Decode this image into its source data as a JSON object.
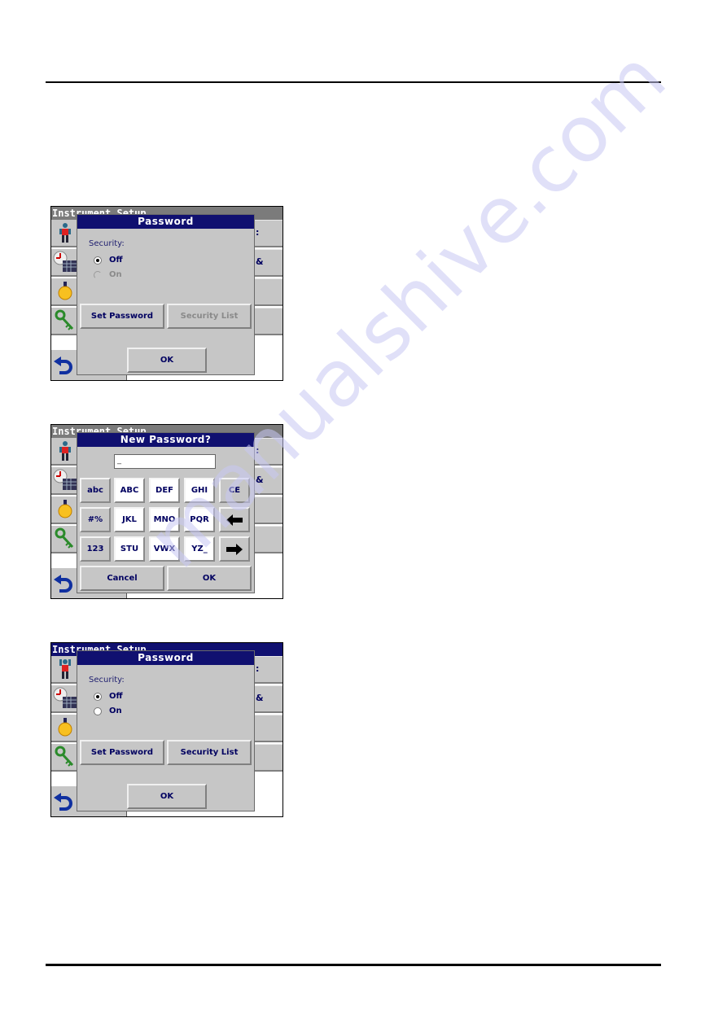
{
  "watermark": "manualshive.com",
  "screens": [
    {
      "app_title": "Instrument Setup",
      "right_buttons": [
        ":",
        "&",
        "",
        ""
      ],
      "dialog": {
        "title": "Password",
        "security_label": "Security:",
        "options": [
          {
            "label": "Off",
            "checked": true,
            "enabled": true
          },
          {
            "label": "On",
            "checked": false,
            "enabled": false
          }
        ],
        "set_password": "Set Password",
        "security_list": "Security List",
        "security_list_enabled": false,
        "ok": "OK"
      }
    },
    {
      "app_title": "Instrument Setup",
      "right_buttons": [
        ":",
        "&",
        "",
        ""
      ],
      "dialog": {
        "title": "New Password?",
        "input_value": "_",
        "keys": [
          [
            "abc",
            "ABC",
            "DEF",
            "GHI",
            "CE"
          ],
          [
            "#%",
            "JKL",
            "MNO",
            "PQR",
            "backspace-arrow"
          ],
          [
            "123",
            "STU",
            "VWX",
            "YZ_",
            "forward-arrow"
          ]
        ],
        "cancel": "Cancel",
        "ok": "OK"
      }
    },
    {
      "app_title": "Instrument Setup",
      "right_buttons": [
        ":",
        "&",
        "",
        ""
      ],
      "dialog": {
        "title": "Password",
        "security_label": "Security:",
        "options": [
          {
            "label": "Off",
            "checked": true,
            "enabled": true
          },
          {
            "label": "On",
            "checked": false,
            "enabled": true
          }
        ],
        "set_password": "Set Password",
        "security_list": "Security List",
        "security_list_enabled": true,
        "ok": "OK"
      }
    }
  ],
  "icons": {
    "side": [
      "operator-id-icon",
      "date-time-icon",
      "lamp-icon",
      "password-key-icon"
    ],
    "back": "back-arrow-icon"
  },
  "colors": {
    "title_bar": "#101070",
    "inactive_title": "#7b7b7b",
    "panel": "#c6c6c6",
    "text": "#000060"
  }
}
